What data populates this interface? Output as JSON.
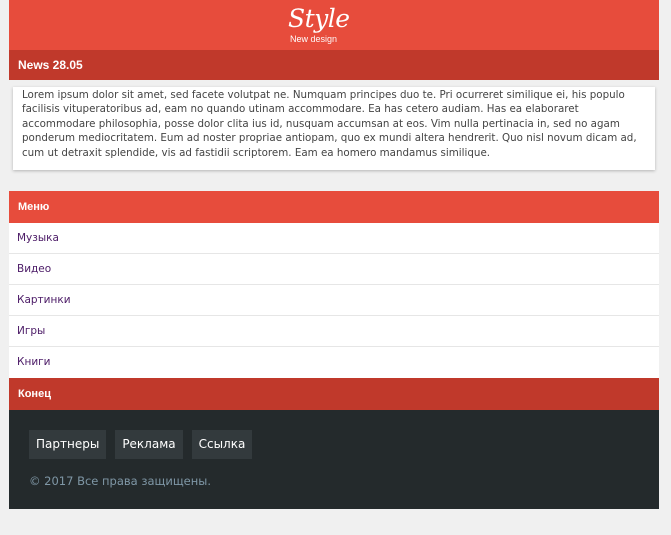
{
  "header": {
    "logo_title": "Style",
    "logo_subtitle_new": "New",
    "logo_subtitle_design": "design"
  },
  "news": {
    "title": "News 28.05",
    "body": "Lorem ipsum dolor sit amet, sed facete volutpat ne. Numquam principes duo te. Pri ocurreret similique ei, his populo facilisis vituperatoribus ad, eam no quando utinam accommodare. Ea has cetero audiam. Has ea elaboraret accommodare philosophia, posse dolor clita ius id, nusquam accumsan at eos. Vim nulla pertinacia in, sed no agam ponderum mediocritatem. Eum ad noster propriae antiopam, quo ex mundi altera hendrerit. Quo nisl novum dicam ad, cum ut detraxit splendide, vis ad fastidii scriptorem. Eam ea homero mandamus similique."
  },
  "menu": {
    "title": "Меню",
    "items": [
      {
        "label": "Музыка"
      },
      {
        "label": "Видео"
      },
      {
        "label": "Картинки"
      },
      {
        "label": "Игры"
      },
      {
        "label": "Книги"
      }
    ],
    "end_title": "Конец"
  },
  "footer": {
    "links": [
      {
        "label": "Партнеры"
      },
      {
        "label": "Реклама"
      },
      {
        "label": "Ссылка"
      }
    ],
    "copyright": "© 2017 Все права защищены."
  },
  "colors": {
    "accent": "#e74c3c",
    "accent_dark": "#c0392b",
    "footer_bg": "#242a2c",
    "link": "#4b1a66"
  }
}
